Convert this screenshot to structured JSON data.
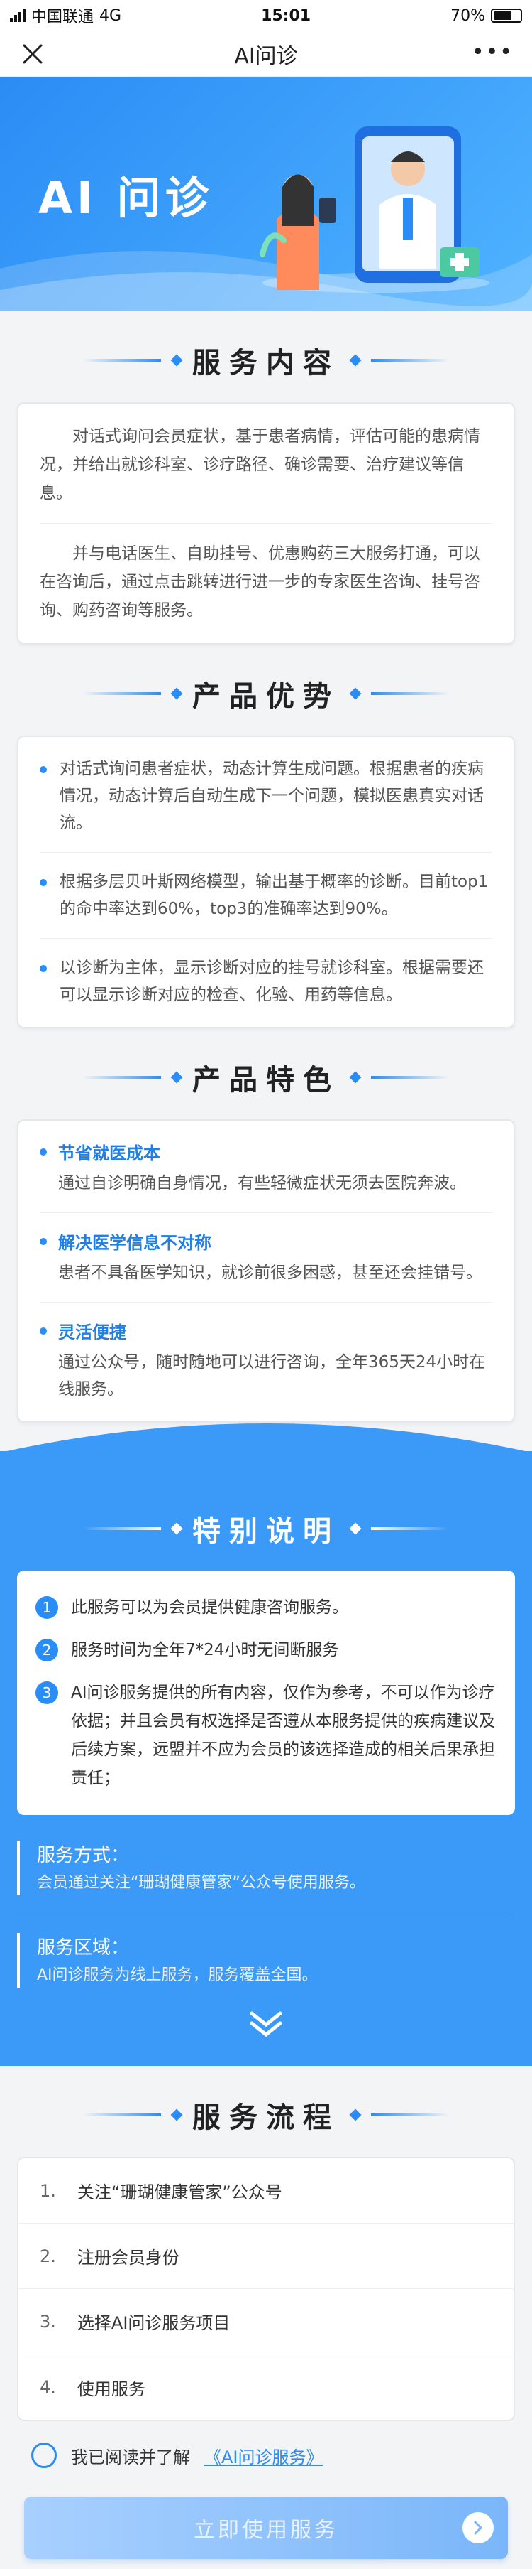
{
  "status_bar": {
    "carrier": "中国联通",
    "network": "4G",
    "time": "15:01",
    "battery": "70%"
  },
  "nav": {
    "title": "AI问诊",
    "close_icon": "close-icon",
    "more_icon": "more-icon"
  },
  "hero": {
    "brand_text": "AI 问诊"
  },
  "service_content": {
    "title": "服务内容",
    "paragraphs": [
      "对话式询问会员症状，基于患者病情，评估可能的患病情况，并给出就诊科室、诊疗路径、确诊需要、治疗建议等信息。",
      "并与电话医生、自助挂号、优惠购药三大服务打通，可以在咨询后，通过点击跳转进行进一步的专家医生咨询、挂号咨询、购药咨询等服务。"
    ]
  },
  "product_advantages": {
    "title": "产品优势",
    "items": [
      "对话式询问患者症状，动态计算生成问题。根据患者的疾病情况，动态计算后自动生成下一个问题，模拟医患真实对话流。",
      "根据多层贝叶斯网络模型，输出基于概率的诊断。目前top1的命中率达到60%，top3的准确率达到90%。",
      "以诊断为主体，显示诊断对应的挂号就诊科室。根据需要还可以显示诊断对应的检查、化验、用药等信息。"
    ]
  },
  "product_features": {
    "title": "产品特色",
    "items": [
      {
        "heading": "节省就医成本",
        "desc": "通过自诊明确自身情况，有些轻微症状无须去医院奔波。"
      },
      {
        "heading": "解决医学信息不对称",
        "desc": "患者不具备医学知识，就诊前很多困惑，甚至还会挂错号。"
      },
      {
        "heading": "灵活便捷",
        "desc": "通过公众号，随时随地可以进行咨询，全年365天24小时在线服务。"
      }
    ]
  },
  "special_notes": {
    "title": "特别说明",
    "items": [
      {
        "num": "1",
        "text": "此服务可以为会员提供健康咨询服务。"
      },
      {
        "num": "2",
        "text": "服务时间为全年7*24小时无间断服务"
      },
      {
        "num": "3",
        "text": "AI问诊服务提供的所有内容，仅作为参考，不可以作为诊疗依据；并且会员有权选择是否遵从本服务提供的疾病建议及后续方案，远盟并不应为会员的该选择造成的相关后果承担责任；"
      }
    ],
    "method_label": "服务方式：",
    "method_value": "会员通过关注“珊瑚健康管家”公众号使用服务。",
    "area_label": "服务区域：",
    "area_value": "AI问诊服务为线上服务，服务覆盖全国。"
  },
  "service_flow": {
    "title": "服务流程",
    "steps": [
      {
        "num": "1.",
        "text": "关注“珊瑚健康管家”公众号"
      },
      {
        "num": "2.",
        "text": "注册会员身份"
      },
      {
        "num": "3.",
        "text": "选择AI问诊服务项目"
      },
      {
        "num": "4.",
        "text": "使用服务"
      }
    ]
  },
  "agreement": {
    "prefix": "我已阅读并了解",
    "link": "《AI问诊服务》"
  },
  "cta": {
    "label": "立即使用服务"
  },
  "colors": {
    "accent": "#2a8cf5",
    "special_bg": "#3b99f7"
  }
}
